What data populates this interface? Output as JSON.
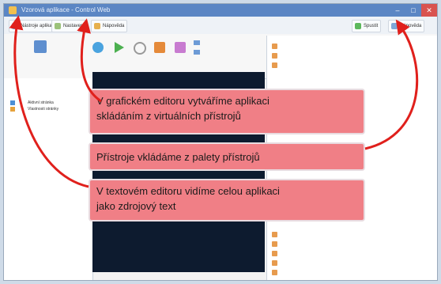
{
  "window": {
    "title": "Vzorová aplikace - Control Web"
  },
  "toolbar": {
    "btn1": "Nástroje aplikace",
    "btn2": "Nastavení",
    "btn3": "Nápověda",
    "right1": "Spustit",
    "right2": "Nápověda"
  },
  "callouts": {
    "c1": "V grafickém editoru vytváříme aplikaci skládáním z virtuálních přístrojů",
    "c1_line1": "V grafickém editoru vytváříme aplikaci",
    "c1_line2": "skládáním z virtuálních přístrojů",
    "c2": "Přístroje vkládáme z palety přístrojů",
    "c3_line1": "V textovém editoru vidíme celou aplikaci",
    "c3_line2": "jako zdrojový text"
  },
  "leftpanel": {
    "item1": "Aktivní stránka",
    "item2": "Vlastnosti stránky"
  },
  "colors": {
    "arrow": "#e0201c",
    "callout_bg": "#f07f86",
    "editor_bg": "#0d1b2f"
  }
}
